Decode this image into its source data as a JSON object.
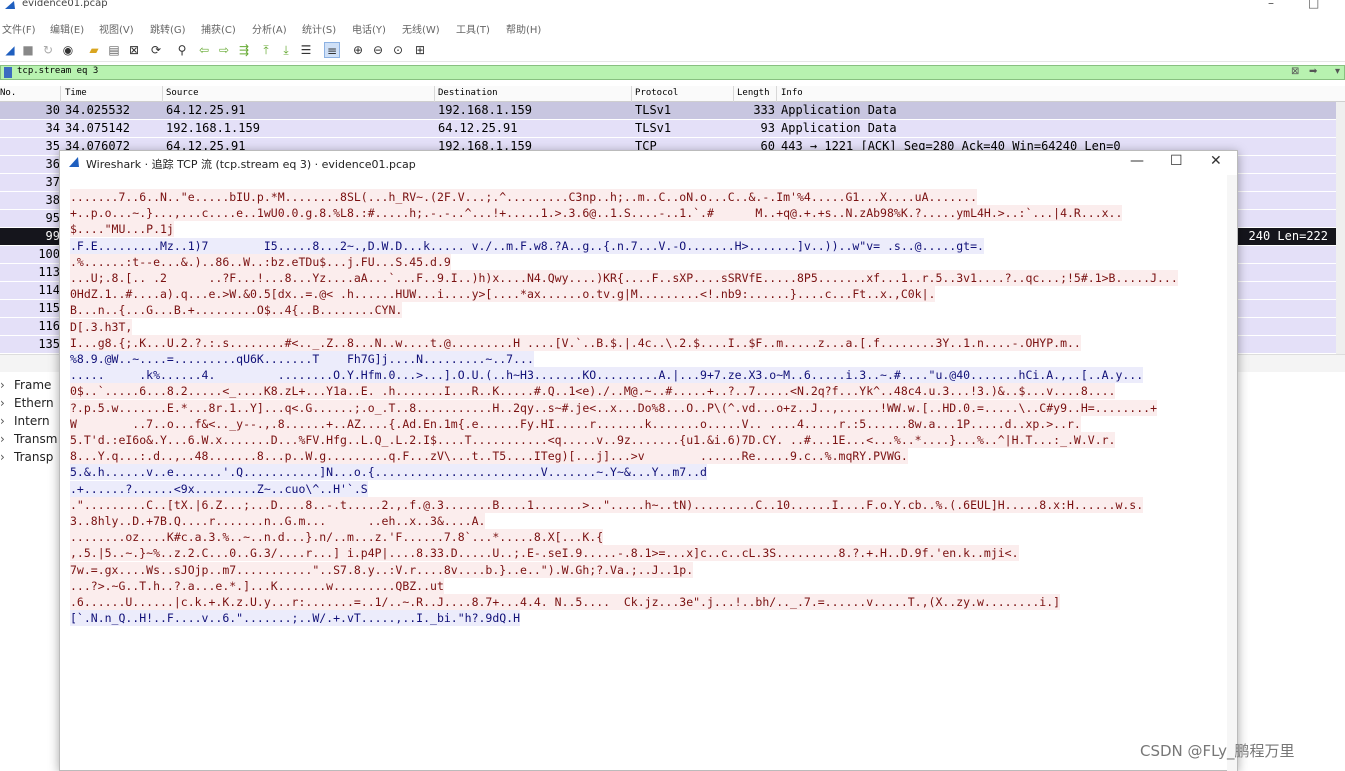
{
  "window": {
    "title": "evidence01.pcap",
    "controls": {
      "minimize": "–",
      "maximize": "□"
    }
  },
  "menu": [
    "文件(F)",
    "编辑(E)",
    "视图(V)",
    "跳转(G)",
    "捕获(C)",
    "分析(A)",
    "统计(S)",
    "电话(Y)",
    "无线(W)",
    "工具(T)",
    "帮助(H)"
  ],
  "toolbar_icons": [
    "shark-fin-start-icon",
    "stop-icon",
    "restart-icon",
    "options-icon",
    "open-folder-icon",
    "save-icon",
    "close-file-icon",
    "reload-icon",
    "find-icon",
    "back-icon",
    "forward-icon",
    "goto-icon",
    "first-packet-icon",
    "last-packet-icon",
    "autoscroll-icon",
    "colorize-icon",
    "zoom-in-icon",
    "zoom-out-icon",
    "zoom-normal-icon",
    "resize-columns-icon"
  ],
  "filter": {
    "value": "tcp.stream eq 3"
  },
  "packet_list": {
    "columns": [
      "No.",
      "Time",
      "Source",
      "Destination",
      "Protocol",
      "Length",
      "Info"
    ],
    "rows": [
      {
        "no": "30",
        "time": "34.025532",
        "source": "64.12.25.91",
        "destination": "192.168.1.159",
        "protocol": "TLSv1",
        "length": "333",
        "info": "Application Data"
      },
      {
        "no": "34",
        "time": "34.075142",
        "source": "192.168.1.159",
        "destination": "64.12.25.91",
        "protocol": "TLSv1",
        "length": "93",
        "info": "Application Data"
      },
      {
        "no": "35",
        "time": "34.076072",
        "source": "64.12.25.91",
        "destination": "192.168.1.159",
        "protocol": "TCP",
        "length": "60",
        "info": "443 → 1221 [ACK] Seq=280 Ack=40 Win=64240 Len=0"
      },
      {
        "no": "36",
        "time": "",
        "source": "",
        "destination": "",
        "protocol": "",
        "length": "",
        "info": ""
      },
      {
        "no": "37",
        "time": "",
        "source": "",
        "destination": "",
        "protocol": "",
        "length": "",
        "info": ""
      },
      {
        "no": "38",
        "time": "",
        "source": "",
        "destination": "",
        "protocol": "",
        "length": "",
        "info": ""
      },
      {
        "no": "95",
        "time": "",
        "source": "",
        "destination": "",
        "protocol": "",
        "length": "",
        "info": ""
      },
      {
        "no": "99",
        "time": "",
        "source": "",
        "destination": "",
        "protocol": "",
        "length": "",
        "info": "240 Len=222"
      },
      {
        "no": "100",
        "time": "",
        "source": "",
        "destination": "",
        "protocol": "",
        "length": "",
        "info": ""
      },
      {
        "no": "113",
        "time": "",
        "source": "",
        "destination": "",
        "protocol": "",
        "length": "",
        "info": ""
      },
      {
        "no": "114",
        "time": "",
        "source": "",
        "destination": "",
        "protocol": "",
        "length": "",
        "info": ""
      },
      {
        "no": "115",
        "time": "",
        "source": "",
        "destination": "",
        "protocol": "",
        "length": "",
        "info": ""
      },
      {
        "no": "116",
        "time": "",
        "source": "",
        "destination": "",
        "protocol": "",
        "length": "",
        "info": ""
      },
      {
        "no": "135",
        "time": "",
        "source": "",
        "destination": "",
        "protocol": "",
        "length": "",
        "info": ""
      }
    ]
  },
  "details": [
    "Frame",
    "Ethern",
    "Intern",
    "Transm",
    "Transp"
  ],
  "dialog": {
    "title": "Wireshark · 追踪 TCP 流 (tcp.stream eq 3) · evidence01.pcap",
    "controls": {
      "minimize": "—",
      "maximize": "☐",
      "close": "✕"
    },
    "lines": [
      {
        "dir": "c",
        "text": ".......7..6..N..\"e.....bIU.p.*M........8SL(...h_RV~.(2F.V...;.^.........C3np..h;..m..C..oN.o...C..&.-.Im'%4.....G1...X....uA......."
      },
      {
        "dir": "c",
        "text": "+..p.o...~.}...,...c....e..1wU0.0.g.8.%L8.:#.....h;.-.-..^...!+.....1.>.3.6@..1.S....-..1.`.#      M..+q@.+.+s..N.zAb98%K.?.....ymL4H.>..:`...|4.R...x.."
      },
      {
        "dir": "c",
        "text": "$....\"MU...P.1j"
      },
      {
        "dir": "s",
        "text": ".F.E.........Mz..1)7        I5.....8...2~.,D.W.D...k..... v./..m.F.w8.?A..g..{.n.7...V.-O.......H>.......]v..))..w\"v= .s..@.....gt=."
      },
      {
        "dir": "c",
        "text": ".%......:t--e...&.)..86..W..:bz.eTDu$...j.FU...S.45.d.9"
      },
      {
        "dir": "c",
        "text": "...U;.8.[.. .2      ..?F...!...8...Yz....aA...`...F..9.I..)h)x....N4.Qwy....)KR{....F..sXP....sSRVfE.....8P5.......xf...1..r.5..3v1....?..qc...;!5#.1>B.....J..."
      },
      {
        "dir": "c",
        "text": "0HdZ.1..#....a).q...e.>W.&0.5[dx..=.@< .h......HUW...i....y>[....*ax......o.tv.g|M.........<!.nb9:......}....c...Ft..x.,C0k|."
      },
      {
        "dir": "c",
        "text": "B...n..{...G...B.+.........O$..4{..B........CYN."
      },
      {
        "dir": "c",
        "text": "D[.3.h3T,"
      },
      {
        "dir": "c",
        "text": "I...g8.{;.K...U.2.?.:.s........#<.._.Z..8...N..w....t.@.........H ....[V.`..B.$.|.4c..\\.2.$....I..$F..m.....z...a.[.f........3Y..1.n....-.OHYP.m.."
      },
      {
        "dir": "s",
        "text": "%8.9.@W..~....=.........qU6K.......T    Fh7G]j....N.........~..7..."
      },
      {
        "dir": "s",
        "text": ".....     .k%......4.         ........O.Y.Hfm.0...>...].O.U.(..h~H3.......KO.........A.|...9+7.ze.X3.o~M..6.....i.3..~.#....\"u.@40.......hCi.A.,..[..A.y..."
      },
      {
        "dir": "c",
        "text": "0$..`.....6...8.2.....<_....K8.zL+...Y1a..E. .h.......I...R..K.....#.Q..1<e)./..M@.~..#.....+..?..7.....<N.2q?f...Yk^..48c4.u.3...!3.)&..$...v....8...."
      },
      {
        "dir": "c",
        "text": "?.p.5.w.......E.*...8r.1..Y]...q<.G......;.o_.T..8...........H..2qy..s~#.je<..x...Do%8...O..P\\(^.vd...o+z..J..,......!WW.w.[..HD.0.=.....\\..C#y9..H=........+"
      },
      {
        "dir": "c",
        "text": "W        ..7..o...f&<.._y--.,.8......+..AZ....{.Ad.En.1m{.e......Fy.HI.....r.......k.......o.....V.. ....4.....r.:5......8w.a...1P.....d..xp.>..r."
      },
      {
        "dir": "c",
        "text": "5.T'd.:eI6o&.Y...6.W.x.......D...%FV.Hfg..L.Q_.L.2.I$....T...........<q.....v..9z.......{u1.&i.6)7D.CY. ..#...1E...<...%..*....}...%..^|H.T...:_.W.V.r."
      },
      {
        "dir": "c",
        "text": "8...Y.q...:.d..,..48.......8...p..W.g.........q.F...zV\\...t..T5....ITeg)[...j]...>v        ......Re.....9.c..%.mqRY.PVWG."
      },
      {
        "dir": "s",
        "text": "5.&.h......v..e.......'.Q...........]N...o.{........................V.......~.Y~&...Y..m7..d"
      },
      {
        "dir": "s",
        "text": ".+......?......<9x.........Z~..cuo\\^..H'`.S"
      },
      {
        "dir": "c",
        "text": ".\".........C..[tX.|6.Z...;...D....8..-.t.....2.,.f.@.3.......B....1.......>..\".....h~..tN).........C..10......I....F.o.Y.cb..%.(.6EUL]H.....8.x:H......w.s."
      },
      {
        "dir": "c",
        "text": "3..8hly..D.+7B.Q....r.......n..G.m...      ..eh..x..3&....A."
      },
      {
        "dir": "c",
        "text": "........oz....K#c.a.3.%..~..n.d...}.n/..m...z.'F......7.8`...*.....8.X[...K.{"
      },
      {
        "dir": "c",
        "text": ",.5.|5..~.}~%..z.2.C...0..G.3/....r...] i.p4P|....8.33.D.....U..;.E-.seI.9.....-.8.1>=...x]c..c..cL.3S.........8.?.+.H..D.9f.'en.k..mji<."
      },
      {
        "dir": "c",
        "text": "7w.=.gx....Ws..sJOjp..m7...........\"..S7.8.y..:V.r....8v....b.}..e..\").W.Gh;?.Va.;..J..1p."
      },
      {
        "dir": "c",
        "text": "...?>.~G..T.h..?.a...e.*.]...K.......w.........QBZ..ut"
      },
      {
        "dir": "c",
        "text": ".6......U......|c.k.+.K.z.U.y...r:.......=..1/..~.R..J....8.7+...4.4. N..5....  Ck.jz...3e\".j...!..bh/.._.7.=......v.....T.,(X..zy.w........i.]"
      },
      {
        "dir": "s",
        "text": "[`.N.n_Q..H!..F....v..6.\".......;..W/.+.vT.....,..I._bi.\"h?.9dQ.H"
      }
    ]
  },
  "watermark": "CSDN @FLy_鹏程万里",
  "colors": {
    "filter_bg": "#b8f2b0",
    "row_bg": "#e4e0f8",
    "client_text": "#7a1111",
    "client_bg": "#fbeded",
    "server_text": "#101078",
    "server_bg": "#ececfb"
  }
}
